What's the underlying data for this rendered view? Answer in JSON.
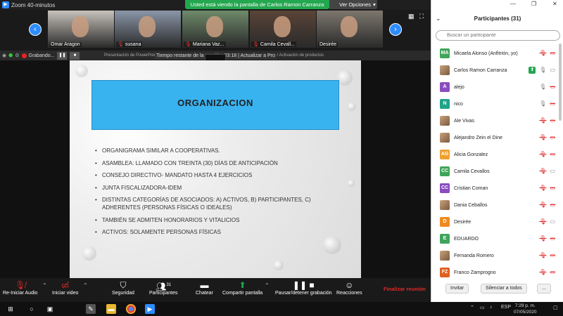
{
  "window": {
    "title": "Zoom 40-minutos"
  },
  "share_banner": "Usted está viendo la pantalla de Carlos Ramon Carranza",
  "view_options": "Ver Opciones",
  "thumbnails": [
    {
      "name": "Omar Aragon",
      "muted": false,
      "bg": "#c7c2bb"
    },
    {
      "name": "susana",
      "muted": true,
      "bg": "#8a96a8"
    },
    {
      "name": "Mariana Vaz...",
      "muted": true,
      "bg": "#6f8a6a"
    },
    {
      "name": "Camila Cevall...",
      "muted": true,
      "bg": "#5a4438"
    },
    {
      "name": "Desirée",
      "muted": false,
      "bg": "#7d776e"
    }
  ],
  "recording": {
    "label": "Grabando..."
  },
  "ppt_bar": "Presentación de PowerPoint - [Introducción a la Economía Social] - Actualizar a PowerPoint / Activación de productos",
  "timer_text": "Tiempo restante de la reunión: 03:18 | Actualizar a Pro",
  "slide": {
    "title": "ORGANIZACION",
    "bullets": [
      {
        "text": "ORGANIGRAMA  SIMILAR A COOPERATIVAS."
      },
      {
        "text": "ASAMBLEA: LLAMADO CON TREINTA (30) DÍAS DE ANTICIPACIÓN"
      },
      {
        "text": "CONSEJO DIRECTIVO- MANDATO HASTA 4 EJERCICIOS"
      },
      {
        "text": "JUNTA FISCALIZADORA-IDEM"
      },
      {
        "text": "DISTINTAS CATEGORÍAS DE ASOCIADOS: A) ACTIVOS, B) PARTICIPANTES, C) ADHERENTES (PERSONAS FÍSICAS O IDEALES)"
      },
      {
        "text": "TAMBIÉN SE ADMITEN HONORARIOS Y VITALICIOS"
      },
      {
        "text": "ACTIVOS: SOLAMENTE PERSONAS FÍSICAS"
      }
    ]
  },
  "toolbar": {
    "audio": "Re-Iniciar Audio",
    "video": "Iniciar video",
    "security": "Seguridad",
    "participants": "Participantes",
    "participants_count": "31",
    "chat": "Chatear",
    "share": "Compartir pantalla",
    "record": "Pausar/detener grabación",
    "reactions": "Reacciones",
    "end": "Finalizar reunión"
  },
  "panel": {
    "title": "Participantes (31)",
    "search_placeholder": "Buscar un participante",
    "participants": [
      {
        "name": "Micaela Alonso (Anfitrión, yo)",
        "initials": "MA",
        "color": "#3fa55a",
        "photo": false,
        "icons": [
          "mic-muted",
          "video-off"
        ]
      },
      {
        "name": "Carlos Ramon Carranza",
        "initials": "",
        "color": "",
        "photo": true,
        "icons": [
          "screen-share",
          "mic",
          "video"
        ]
      },
      {
        "name": "alejo",
        "initials": "A",
        "color": "#8a4dbf",
        "photo": false,
        "icons": [
          "mic",
          "video-off"
        ]
      },
      {
        "name": "nico",
        "initials": "N",
        "color": "#1fa389",
        "photo": false,
        "icons": [
          "mic",
          "video-off"
        ]
      },
      {
        "name": "Ale    Vivas",
        "initials": "",
        "color": "",
        "photo": true,
        "icons": [
          "mic-muted",
          "video-off"
        ]
      },
      {
        "name": "Alejandro Zein el Dine",
        "initials": "",
        "color": "",
        "photo": true,
        "icons": [
          "mic-muted",
          "video-off"
        ]
      },
      {
        "name": "Alicia Gonzalez",
        "initials": "AG",
        "color": "#f0a030",
        "photo": false,
        "icons": [
          "mic-muted",
          "video-off"
        ]
      },
      {
        "name": "Camila Cevallos",
        "initials": "CC",
        "color": "#3fa55a",
        "photo": false,
        "icons": [
          "mic-muted",
          "video"
        ]
      },
      {
        "name": "Cristian Coman",
        "initials": "CC",
        "color": "#8a4dbf",
        "photo": false,
        "icons": [
          "mic-muted",
          "video-off"
        ]
      },
      {
        "name": "Dania Ceballos",
        "initials": "",
        "color": "",
        "photo": true,
        "icons": [
          "mic-muted",
          "video-off"
        ]
      },
      {
        "name": "Desirée",
        "initials": "D",
        "color": "#f08a20",
        "photo": false,
        "icons": [
          "mic-muted",
          "video"
        ]
      },
      {
        "name": "EDUARDO",
        "initials": "E",
        "color": "#3fa55a",
        "photo": false,
        "icons": [
          "mic-muted",
          "video-off"
        ]
      },
      {
        "name": "Fernanda Romero",
        "initials": "",
        "color": "",
        "photo": true,
        "icons": [
          "mic-muted",
          "video-off"
        ]
      },
      {
        "name": "Franco Zamprogno",
        "initials": "FZ",
        "color": "#e06020",
        "photo": false,
        "icons": [
          "mic-muted",
          "video-off"
        ]
      }
    ],
    "invite": "Invitar",
    "mute_all": "Silenciar a todos",
    "more": "..."
  },
  "taskbar": {
    "lang": "ESP",
    "time": "7:29 p. m.",
    "date": "07/05/2020"
  }
}
